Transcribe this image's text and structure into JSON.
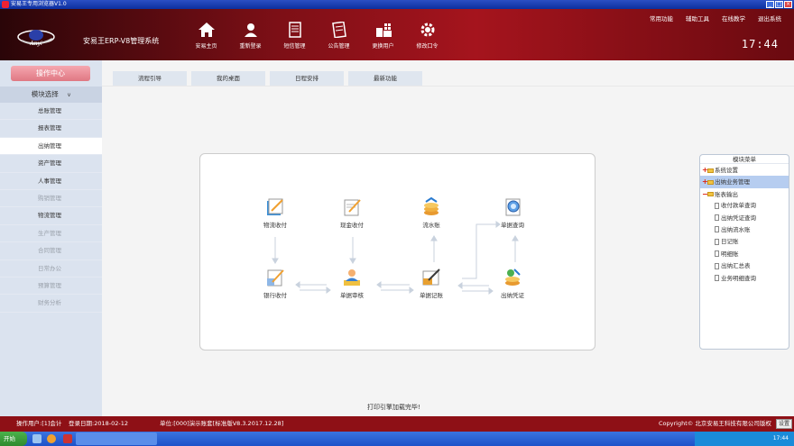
{
  "window": {
    "title": "安易王专用浏览器V1.0"
  },
  "header": {
    "brand_logo_text": "Anyi",
    "system_name": "安易王ERP-V8管理系统",
    "clock": "17:44",
    "nav": [
      {
        "label": "安易主页",
        "icon": "home-icon"
      },
      {
        "label": "重新登录",
        "icon": "relogin-icon"
      },
      {
        "label": "短信管理",
        "icon": "sms-icon"
      },
      {
        "label": "公告管理",
        "icon": "notice-icon"
      },
      {
        "label": "更换用户",
        "icon": "switch-user-icon"
      },
      {
        "label": "修改口令",
        "icon": "gear-icon"
      }
    ],
    "top_links": [
      "常用功能",
      "辅助工具",
      "在线教学",
      "退出系统"
    ]
  },
  "sidebar": {
    "title": "操作中心",
    "module_select": "模块选择",
    "items": [
      {
        "label": "总账管理",
        "state": "normal"
      },
      {
        "label": "报表管理",
        "state": "normal"
      },
      {
        "label": "出纳管理",
        "state": "active"
      },
      {
        "label": "资产管理",
        "state": "normal"
      },
      {
        "label": "人事管理",
        "state": "normal"
      },
      {
        "label": "购销管理",
        "state": "disabled"
      },
      {
        "label": "物流管理",
        "state": "normal"
      },
      {
        "label": "生产管理",
        "state": "disabled"
      },
      {
        "label": "合同管理",
        "state": "disabled"
      },
      {
        "label": "日常办公",
        "state": "disabled"
      },
      {
        "label": "预算管理",
        "state": "disabled"
      },
      {
        "label": "财务分析",
        "state": "disabled"
      }
    ]
  },
  "tabs": [
    "流程引导",
    "我的桌面",
    "日程安排",
    "最新功能"
  ],
  "flow": {
    "nodes": {
      "wuliu_shoufu": "物流收付",
      "xianjin_shoufu": "现金收付",
      "liushuizhang": "流水账",
      "danju_chaxun": "单据查询",
      "yinhang_shoufu": "银行收付",
      "danju_shenhe": "单据审核",
      "danju_jizhang": "单据记账",
      "chuna_pingzheng": "出纳凭证"
    }
  },
  "tree": {
    "title": "模块菜单",
    "items": [
      {
        "label": "系统设置",
        "type": "folder",
        "sign": "+",
        "level": 0
      },
      {
        "label": "出纳业务管理",
        "type": "folder",
        "sign": "+",
        "level": 0,
        "selected": true
      },
      {
        "label": "账表输出",
        "type": "folder-open",
        "sign": "−",
        "level": 0
      },
      {
        "label": "收付款单查询",
        "type": "doc",
        "level": 1
      },
      {
        "label": "出纳凭证查询",
        "type": "doc",
        "level": 1
      },
      {
        "label": "出纳流水账",
        "type": "doc",
        "level": 1
      },
      {
        "label": "日记账",
        "type": "doc",
        "level": 1
      },
      {
        "label": "明细账",
        "type": "doc",
        "level": 1
      },
      {
        "label": "出纳汇总表",
        "type": "doc",
        "level": 1
      },
      {
        "label": "业务明细查询",
        "type": "doc",
        "level": 1
      }
    ]
  },
  "status": {
    "message": "打印引擎加载完毕!",
    "operator": "操作用户:[1]会计",
    "login_date": "登录日期:2018-02-12",
    "unit": "单位:[000]演示账套[标准版V8.3.2017.12.28]",
    "copyright": "Copyright© 北京安易王科技有限公司版权",
    "settings": "设置"
  },
  "taskbar": {
    "start": "开始",
    "clock": "17:44"
  },
  "colors": {
    "header_red": "#8e1016",
    "sidebar_bg": "#dbe3ef",
    "tab_bg": "#dfe6ef",
    "accent_pink": "#e07883"
  }
}
